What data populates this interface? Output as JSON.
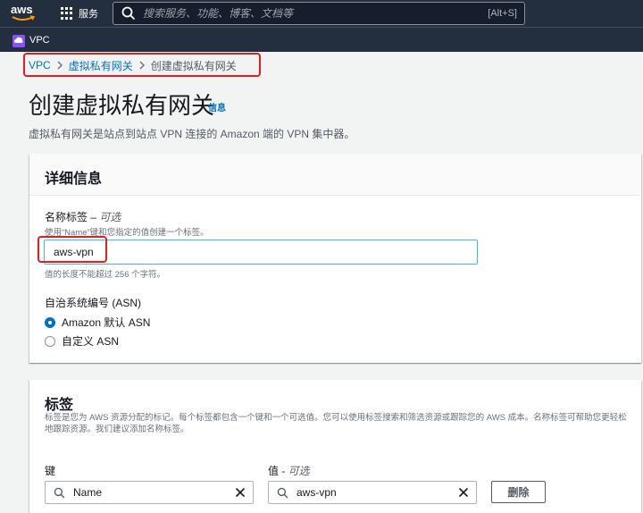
{
  "topnav": {
    "logo_text": "aws",
    "services_label": "服务",
    "search_placeholder": "搜索服务、功能、博客、文档等",
    "search_shortcut": "[Alt+S]"
  },
  "servicebar": {
    "service_name": "VPC"
  },
  "breadcrumb": {
    "items": [
      "VPC",
      "虚拟私有网关",
      "创建虚拟私有网关"
    ]
  },
  "header": {
    "title": "创建虚拟私有网关",
    "info_link": "信息",
    "description": "虚拟私有网关是站点到站点 VPN 连接的 Amazon 端的 VPN 集中器。"
  },
  "details": {
    "title": "详细信息",
    "name_label": "名称标签 – ",
    "name_optional": "可选",
    "name_hint": "使用“Name”键和您指定的值创建一个标签。",
    "name_value": "aws-vpn",
    "length_hint": "值的长度不能超过 256 个字符。",
    "asn_label": "自治系统编号 (ASN)",
    "asn_options": [
      "Amazon 默认 ASN",
      "自定义 ASN"
    ],
    "asn_selected": "Amazon 默认 ASN"
  },
  "tags": {
    "title": "标签",
    "description": "标签是您为 AWS 资源分配的标记。每个标签都包含一个键和一个可选值。您可以使用标签搜索和筛选资源或跟踪您的 AWS 成本。名称标签可帮助您更轻松地跟踪资源。我们建议添加名称标签。",
    "key_label": "键",
    "value_label": "值 - ",
    "value_optional": "可选",
    "key_value": "Name",
    "value_value": "aws-vpn",
    "remove_label": "删除"
  },
  "colors": {
    "nav_bg": "#232f3e",
    "link": "#0073bb",
    "highlight": "#e02020",
    "input_focus": "#44b9d6"
  }
}
